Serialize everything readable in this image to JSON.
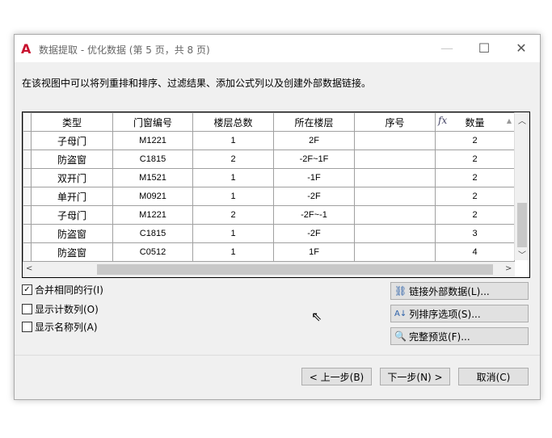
{
  "window": {
    "title": "数据提取 - 优化数据 (第 5 页，共 8 页)",
    "logo": "A"
  },
  "description": "在该视图中可以将列重排和排序、过滤结果、添加公式列以及创建外部数据链接。",
  "table": {
    "columns": [
      "类型",
      "门窗编号",
      "楼层总数",
      "所在楼层",
      "序号",
      "数量"
    ],
    "rows": [
      [
        "子母门",
        "M1221",
        "1",
        "2F",
        "",
        "2"
      ],
      [
        "防盗窗",
        "C1815",
        "2",
        "-2F~1F",
        "",
        "2"
      ],
      [
        "双开门",
        "M1521",
        "1",
        "-1F",
        "",
        "2"
      ],
      [
        "单开门",
        "M0921",
        "1",
        "-2F",
        "",
        "2"
      ],
      [
        "子母门",
        "M1221",
        "2",
        "-2F~-1",
        "",
        "2"
      ],
      [
        "防盗窗",
        "C1815",
        "1",
        "-2F",
        "",
        "3"
      ],
      [
        "防盗窗",
        "C0512",
        "1",
        "1F",
        "",
        "4"
      ]
    ]
  },
  "options": [
    {
      "label": "合并相同的行(I)",
      "checked": true
    },
    {
      "label": "显示计数列(O)",
      "checked": false
    },
    {
      "label": "显示名称列(A)",
      "checked": false
    }
  ],
  "actions": {
    "link": "链接外部数据(L)...",
    "sort": "列排序选项(S)...",
    "preview": "完整预览(F)..."
  },
  "footer": {
    "back": "< 上一步(B)",
    "next": "下一步(N) >",
    "cancel": "取消(C)"
  }
}
